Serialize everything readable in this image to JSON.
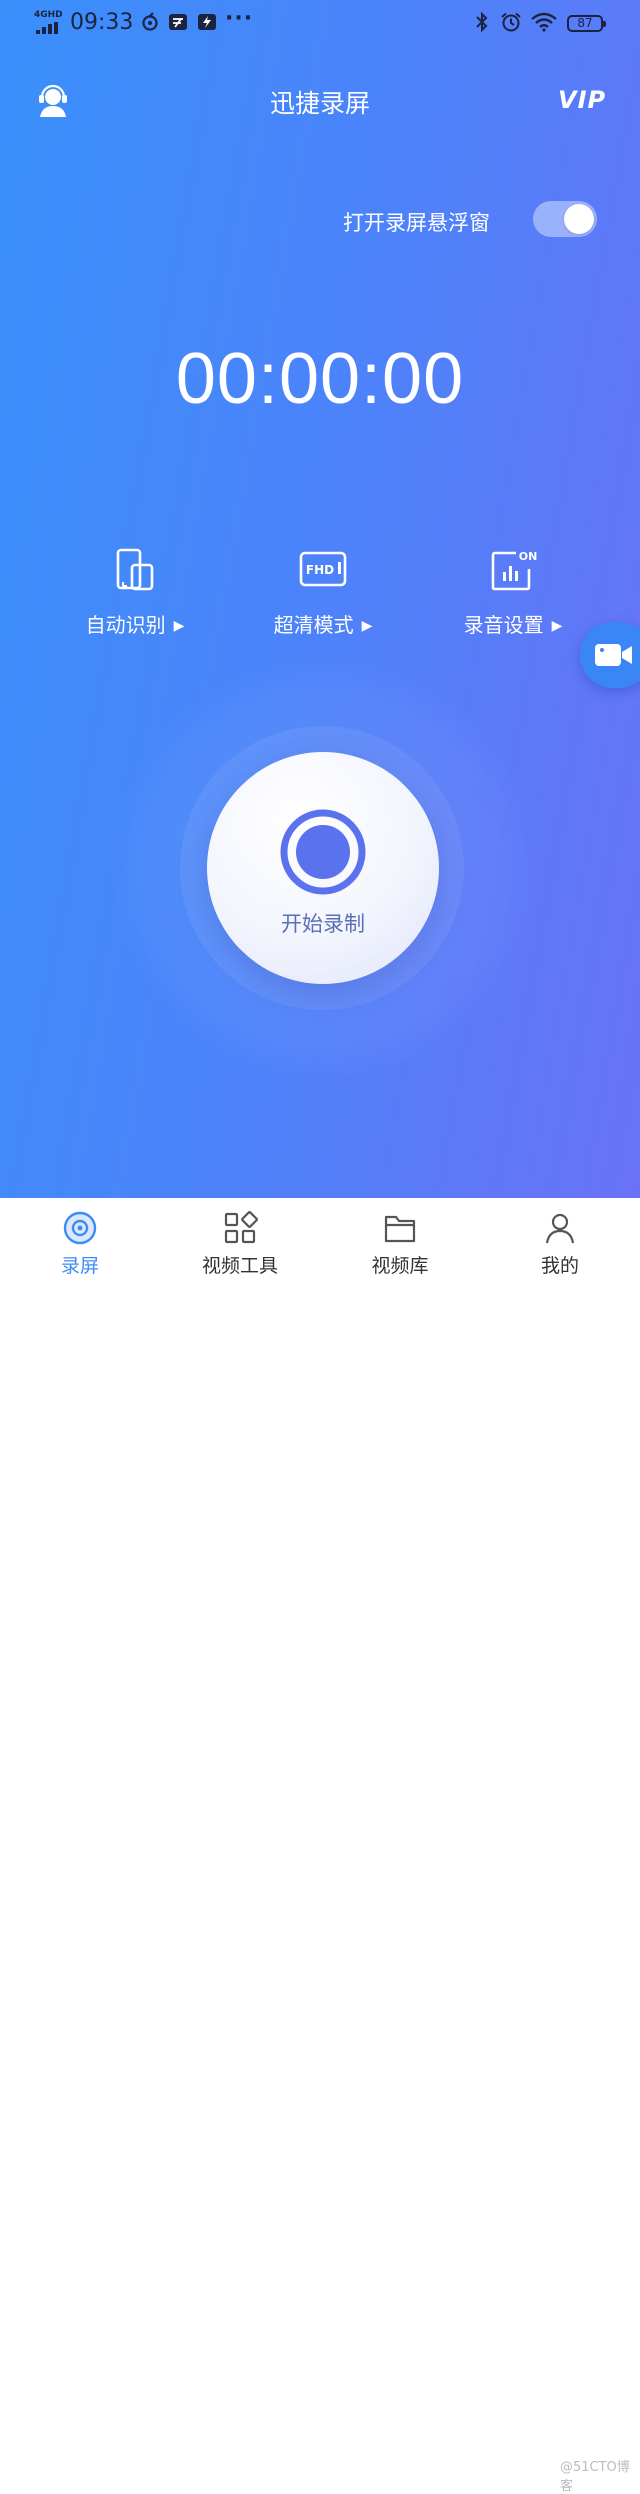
{
  "status_bar": {
    "network": "4GHD",
    "time": "09:33",
    "overflow": "···",
    "battery": "87"
  },
  "header": {
    "title": "迅捷录屏",
    "vip": "VIP"
  },
  "float_window": {
    "label": "打开录屏悬浮窗",
    "enabled": true
  },
  "timer": "00:00:00",
  "options": [
    {
      "label": "自动识别",
      "icon": "screen-orientation-icon"
    },
    {
      "label": "超清模式",
      "icon": "fhd-icon",
      "icon_text": "FHD"
    },
    {
      "label": "录音设置",
      "icon": "audio-on-icon",
      "icon_text": "ON"
    }
  ],
  "record_button": {
    "label": "开始录制"
  },
  "nav": [
    {
      "label": "录屏",
      "icon": "record-disc-icon",
      "active": true
    },
    {
      "label": "视频工具",
      "icon": "tools-grid-icon",
      "active": false
    },
    {
      "label": "视频库",
      "icon": "folder-icon",
      "active": false
    },
    {
      "label": "我的",
      "icon": "user-icon",
      "active": false
    }
  ],
  "watermark": "@51CTO博客",
  "colors": {
    "gradient_start": "#3a8ffb",
    "gradient_end": "#6a73f7",
    "accent": "#3d8cf6",
    "record_ring": "#5b72ee"
  }
}
